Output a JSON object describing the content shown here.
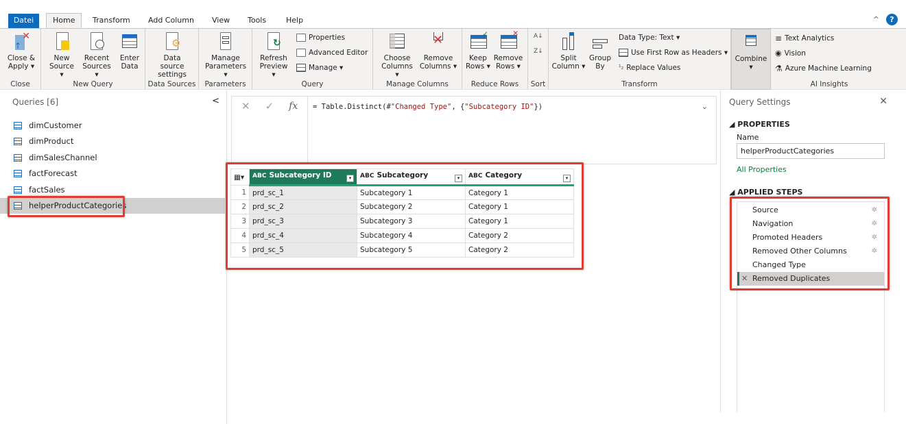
{
  "tabs": [
    "Datei",
    "Home",
    "Transform",
    "Add Column",
    "View",
    "Tools",
    "Help"
  ],
  "ribbon": {
    "close": {
      "btn1": "Close &",
      "btn1b": "Apply ▾",
      "label": "Close"
    },
    "new_query": {
      "new": "New",
      "new_b": "Source ▾",
      "recent": "Recent",
      "recent_b": "Sources ▾",
      "enter": "Enter",
      "enter_b": "Data",
      "label": "New Query"
    },
    "data_sources": {
      "btn": "Data source",
      "btn_b": "settings",
      "label": "Data Sources"
    },
    "parameters": {
      "btn": "Manage",
      "btn_b": "Parameters ▾",
      "label": "Parameters"
    },
    "query": {
      "refresh": "Refresh",
      "refresh_b": "Preview ▾",
      "properties": "Properties",
      "advanced": "Advanced Editor",
      "manage": "Manage ▾",
      "label": "Query"
    },
    "manage_columns": {
      "choose": "Choose",
      "choose_b": "Columns ▾",
      "remove": "Remove",
      "remove_b": "Columns ▾",
      "label": "Manage Columns"
    },
    "reduce_rows": {
      "keep": "Keep",
      "keep_b": "Rows ▾",
      "remove": "Remove",
      "remove_b": "Rows ▾",
      "label": "Reduce Rows"
    },
    "sort": {
      "label": "Sort"
    },
    "transform": {
      "split": "Split",
      "split_b": "Column ▾",
      "group": "Group",
      "group_b": "By",
      "datatype": "Data Type: Text ▾",
      "first_row": "Use First Row as Headers ▾",
      "replace": "Replace Values",
      "label": "Transform"
    },
    "combine": {
      "btn": "Combine",
      "btn_b": "▾"
    },
    "ai": {
      "text": "Text Analytics",
      "vision": "Vision",
      "aml": "Azure Machine Learning",
      "label": "AI Insights"
    }
  },
  "queries": {
    "title": "Queries [6]",
    "items": [
      "dimCustomer",
      "dimProduct",
      "dimSalesChannel",
      "factForecast",
      "factSales",
      "helperProductCategories"
    ]
  },
  "formula": {
    "prefix": "= Table.Distinct(#",
    "s1": "\"Changed Type\"",
    "mid": ", {",
    "s2": "\"Subcategory ID\"",
    "suffix": "})"
  },
  "grid": {
    "columns": [
      "Subcategory ID",
      "Subcategory",
      "Category"
    ],
    "rows": [
      [
        "1",
        "prd_sc_1",
        "Subcategory 1",
        "Category 1"
      ],
      [
        "2",
        "prd_sc_2",
        "Subcategory 2",
        "Category 1"
      ],
      [
        "3",
        "prd_sc_3",
        "Subcategory 3",
        "Category 1"
      ],
      [
        "4",
        "prd_sc_4",
        "Subcategory 4",
        "Category 2"
      ],
      [
        "5",
        "prd_sc_5",
        "Subcategory 5",
        "Category 2"
      ]
    ]
  },
  "settings": {
    "title": "Query Settings",
    "properties": "◢ PROPERTIES",
    "name_label": "Name",
    "name_value": "helperProductCategories",
    "all_properties": "All Properties",
    "applied_steps": "◢ APPLIED STEPS",
    "steps": [
      "Source",
      "Navigation",
      "Promoted Headers",
      "Removed Other Columns",
      "Changed Type",
      "Removed Duplicates"
    ]
  },
  "colors": {
    "accent": "#0f6cbd",
    "selected_column": "#1f7a5a",
    "highlight_box": "#e03c31",
    "link": "#107c41"
  }
}
